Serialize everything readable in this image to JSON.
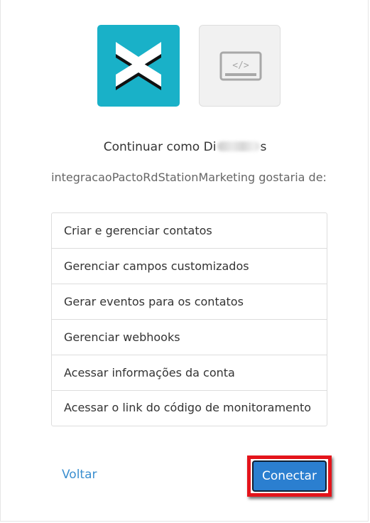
{
  "consent": {
    "continue_prefix": "Continuar como Di",
    "continue_suffix": "s",
    "request_text": "integracaoPactoRdStationMarketing gostaria de:",
    "permissions": [
      "Criar e gerenciar contatos",
      "Gerenciar campos customizados",
      "Gerar eventos para os contatos",
      "Gerenciar webhooks",
      "Acessar informações da conta",
      "Acessar o link do código de monitoramento"
    ],
    "back_label": "Voltar",
    "connect_label": "Conectar"
  },
  "icons": {
    "brand_logo": "rd-station-logo",
    "app_logo": "code-window-icon"
  },
  "colors": {
    "brand_teal": "#19b1c8",
    "link_blue": "#3b8fd0",
    "button_blue": "#2b7fd0",
    "highlight_red": "#e4141b"
  }
}
